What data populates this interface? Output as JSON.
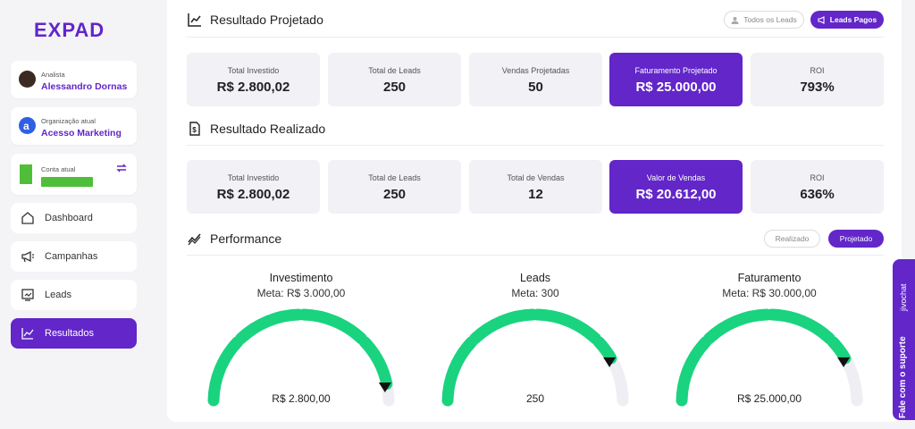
{
  "brand": {
    "logo_text": "EXPAD",
    "accent": "#6226c9",
    "gauge_green": "#19d37f"
  },
  "sidebar": {
    "analyst": {
      "label": "Analista",
      "name": "Alessandro Dornas"
    },
    "organization": {
      "label": "Organização atual",
      "name": "Acesso Marketing"
    },
    "account": {
      "label": "Conta atual"
    },
    "nav": [
      {
        "label": "Dashboard",
        "icon": "home-icon"
      },
      {
        "label": "Campanhas",
        "icon": "megaphone-icon"
      },
      {
        "label": "Leads",
        "icon": "leads-chart-icon"
      },
      {
        "label": "Resultados",
        "icon": "line-chart-icon",
        "active": true
      }
    ]
  },
  "projected": {
    "title": "Resultado Projetado",
    "filter_all": "Todos os Leads",
    "filter_paid": "Leads Pagos",
    "metrics": [
      {
        "label": "Total Investido",
        "value": "R$ 2.800,02"
      },
      {
        "label": "Total de Leads",
        "value": "250"
      },
      {
        "label": "Vendas Projetadas",
        "value": "50"
      },
      {
        "label": "Faturamento Projetado",
        "value": "R$ 25.000,00"
      },
      {
        "label": "ROI",
        "value": "793%"
      }
    ]
  },
  "realized": {
    "title": "Resultado Realizado",
    "metrics": [
      {
        "label": "Total Investido",
        "value": "R$ 2.800,02"
      },
      {
        "label": "Total de Leads",
        "value": "250"
      },
      {
        "label": "Total de Vendas",
        "value": "12"
      },
      {
        "label": "Valor de Vendas",
        "value": "R$ 20.612,00"
      },
      {
        "label": "ROI",
        "value": "636%"
      }
    ]
  },
  "performance": {
    "title": "Performance",
    "toggle_realized": "Realizado",
    "toggle_projected": "Projetado",
    "gauges": [
      {
        "title": "Investimento",
        "meta": "Meta: R$ 3.000,00",
        "value": "R$ 2.800,00",
        "fraction": 0.933
      },
      {
        "title": "Leads",
        "meta": "Meta: 300",
        "value": "250",
        "fraction": 0.833
      },
      {
        "title": "Faturamento",
        "meta": "Meta: R$ 30.000,00",
        "value": "R$ 25.000,00",
        "fraction": 0.833
      }
    ]
  },
  "support": {
    "label": "Fale com o suporte",
    "brand": "jivochat"
  }
}
